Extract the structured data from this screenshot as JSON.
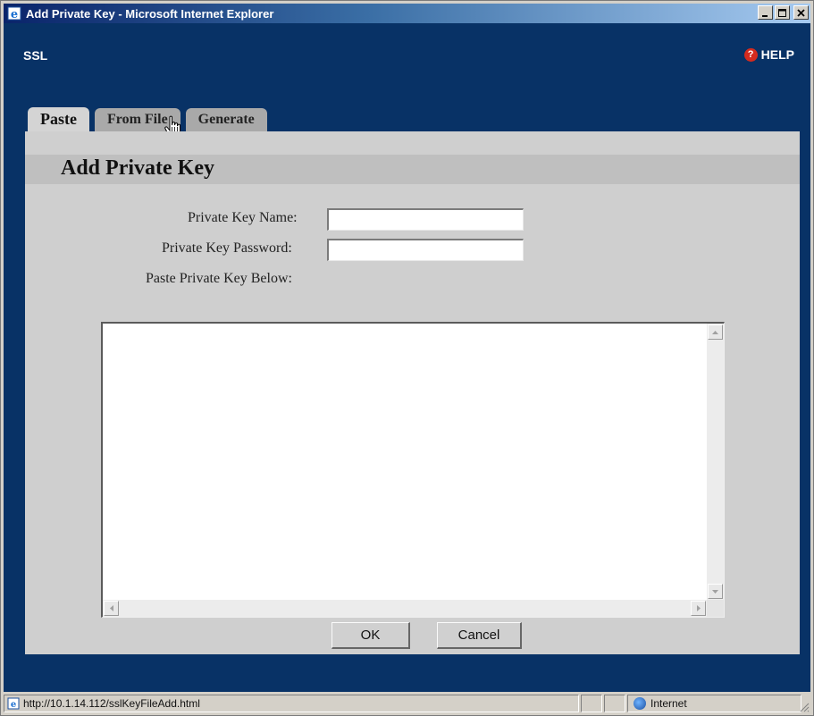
{
  "window": {
    "title": "Add Private Key - Microsoft Internet Explorer",
    "minimize_glyph": "_",
    "maximize_glyph": "□",
    "close_glyph": "✕"
  },
  "header": {
    "brand": "SSL",
    "help_label": "HELP",
    "help_icon_glyph": "?"
  },
  "tabs": [
    {
      "label": "Paste",
      "active": true
    },
    {
      "label": "From File",
      "active": false
    },
    {
      "label": "Generate",
      "active": false
    }
  ],
  "panel": {
    "title": "Add Private Key"
  },
  "form": {
    "key_name_label": "Private Key Name:",
    "key_name_value": "",
    "key_password_label": "Private Key Password:",
    "key_password_value": "",
    "paste_label": "Paste Private Key Below:",
    "paste_value": ""
  },
  "buttons": {
    "ok": "OK",
    "cancel": "Cancel"
  },
  "statusbar": {
    "url": "http://10.1.14.112/sslKeyFileAdd.html",
    "zone": "Internet"
  },
  "colors": {
    "app_background": "#083266",
    "panel": "#cfcfcf",
    "help_icon": "#d52b1e"
  }
}
